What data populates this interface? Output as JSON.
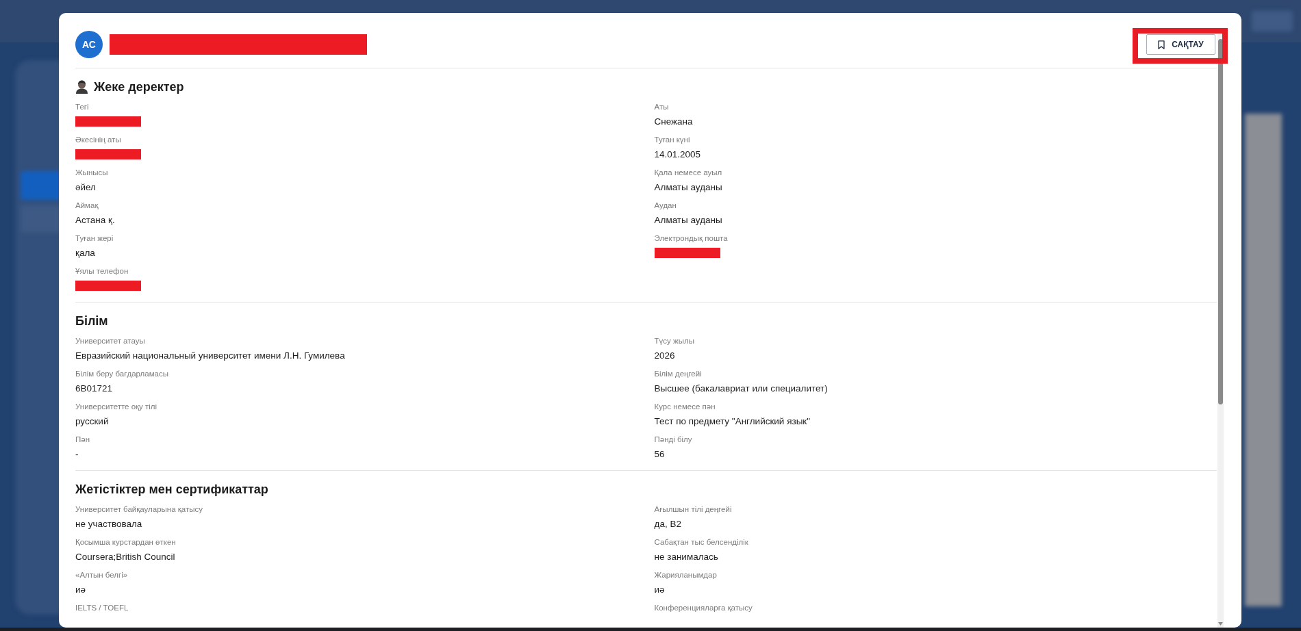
{
  "profile": {
    "initials": "АС",
    "name_redacted": true
  },
  "save_button": {
    "label": "САҚТАУ",
    "highlighted": true
  },
  "sections": [
    {
      "title": "Жеке деректер",
      "icon": true,
      "fields": [
        {
          "label": "Тегі",
          "redacted": true
        },
        {
          "label": "Аты",
          "value": "Снежана",
          "redacted": false
        },
        {
          "label": "Әкесінің аты",
          "redacted": true
        },
        {
          "label": "Туған күні",
          "value": "14.01.2005",
          "redacted": false
        },
        {
          "label": "Жынысы",
          "value": "әйел",
          "redacted": false
        },
        {
          "label": "Қала немесе ауыл",
          "value": "Алматы ауданы",
          "redacted": false
        },
        {
          "label": "Аймақ",
          "value": "Астана қ.",
          "redacted": false
        },
        {
          "label": "Аудан",
          "value": "Алматы ауданы",
          "redacted": false
        },
        {
          "label": "Туған жері",
          "value": "қала",
          "redacted": false
        },
        {
          "label": "Электрондық пошта",
          "redacted": true
        },
        {
          "label": "Ұялы телефон",
          "redacted": true
        }
      ]
    },
    {
      "title": "Білім",
      "icon": false,
      "fields": [
        {
          "label": "Университет атауы",
          "value": "Евразийский национальный университет имени Л.Н. Гумилева",
          "redacted": false
        },
        {
          "label": "Түсу жылы",
          "value": "2026",
          "redacted": false
        },
        {
          "label": "Білім беру бағдарламасы",
          "value": "6B01721",
          "redacted": false
        },
        {
          "label": "Білім деңгейі",
          "value": "Высшее (бакалавриат или специалитет)",
          "redacted": false
        },
        {
          "label": "Университетте оқу тілі",
          "value": "русский",
          "redacted": false
        },
        {
          "label": "Курс немесе пән",
          "value": "Тест по предмету \"Английский язык\"",
          "redacted": false
        },
        {
          "label": "Пән",
          "value": "-",
          "redacted": false
        },
        {
          "label": "Пәнді білу",
          "value": "56",
          "redacted": false
        }
      ]
    },
    {
      "title": "Жетістіктер мен сертификаттар",
      "icon": false,
      "fields": [
        {
          "label": "Университет байқауларына қатысу",
          "value": "не участвовала",
          "redacted": false
        },
        {
          "label": "Ағылшын тілі деңгейі",
          "value": "да, B2",
          "redacted": false
        },
        {
          "label": "Қосымша курстардан өткен",
          "value": "Coursera;British Council",
          "redacted": false
        },
        {
          "label": "Сабақтан тыс белсенділік",
          "value": "не занималась",
          "redacted": false
        },
        {
          "label": "«Алтын белгі»",
          "value": "иә",
          "redacted": false
        },
        {
          "label": "Жарияланымдар",
          "value": "иә",
          "redacted": false
        },
        {
          "label": "IELTS / TOEFL"
        },
        {
          "label": "Конференцияларға қатысу"
        }
      ]
    }
  ]
}
